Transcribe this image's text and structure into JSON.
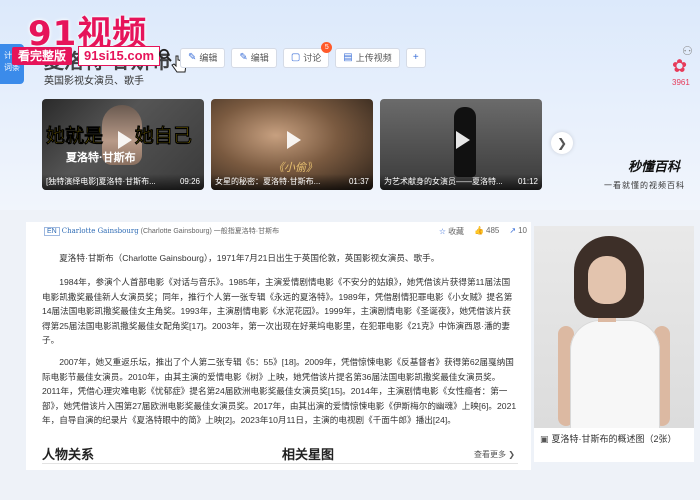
{
  "watermark": {
    "text": "91视频",
    "pill": "看完整版",
    "url": "91si15.com"
  },
  "side_tag": "计划\n词条",
  "header": {
    "title": "夏洛特·甘斯布",
    "subtitle": "英国影视女演员、歌手",
    "toolbar": [
      {
        "icon": "✎",
        "label": "编辑",
        "badge": ""
      },
      {
        "icon": "✎",
        "label": "编辑",
        "badge": ""
      },
      {
        "icon": "▢",
        "label": "讨论",
        "badge": "5"
      },
      {
        "icon": "▤",
        "label": "上传视频",
        "badge": ""
      }
    ],
    "plus_icon": "+",
    "rose_count": "3961"
  },
  "videos": [
    {
      "big": "她就是",
      "big2": "她自己",
      "mid": "夏洛特·甘斯布",
      "caption": "[独特演绎电影]夏洛特·甘斯布...",
      "duration": "09:26"
    },
    {
      "mid": "《小偷》",
      "caption": "女星的秘密：夏洛特·甘斯布...",
      "duration": "01:37"
    },
    {
      "caption": "为艺术献身的女演员——夏洛特...",
      "duration": "01:12"
    }
  ],
  "next_icon": "❯",
  "brand": {
    "name": "秒懂百科",
    "tagline": "一看就懂的视频百科"
  },
  "meta": {
    "tag": "EN",
    "latin": "Charlotte Gainsbourg",
    "latin_paren": "(Charlotte Gainsbourg)",
    "desc": " 一般指夏洛特·甘斯布",
    "collect": "收藏",
    "likes": "485",
    "shares": "10"
  },
  "paragraphs": [
    "夏洛特·甘斯布（Charlotte Gainsbourg），1971年7月21日出生于英国伦敦，英国影视女演员、歌手。",
    "1984年，参演个人首部电影《对话与音乐》。1985年，主演爱情剧情电影《不安分的姑娘》，她凭借该片获得第11届法国电影凯撒奖最佳新人女演员奖；同年，推行个人第一张专辑《永远的夏洛特》。1989年，凭借剧情犯罪电影《小女贼》提名第14届法国电影凯撒奖最佳女主角奖。1993年，主演剧情电影《水泥花园》。1999年，主演剧情电影《圣诞夜》，她凭借该片获得第25届法国电影凯撒奖最佳女配角奖[17]。2003年，第一次出现在好莱坞电影里，在犯罪电影《21克》中饰演西恩·潘的妻子。",
    "2007年，她又重返乐坛，推出了个人第二张专辑《5：55》[18]。2009年，凭借惊悚电影《反基督者》获得第62届戛纳国际电影节最佳女演员。2010年，由其主演的爱情电影《树》上映，她凭借该片提名第36届法国电影凯撒奖最佳女演员奖。2011年，凭借心理灾难电影《忧郁症》提名第24届欧洲电影奖最佳女演员奖[15]。2014年，主演剧情电影《女性瘾者：第一部》，她凭借该片入围第27届欧洲电影奖最佳女演员奖。2017年，由其出演的爱情惊悚电影《伊斯梅尔的幽魂》上映[6]。2021年，自导自演的纪录片《夏洛特眼中的简》上映[2]。2023年10月11日，主演的电视剧《千面牛郎》播出[24]。"
  ],
  "sections": {
    "relations": "人物关系",
    "stars": "相关星图",
    "more": "查看更多 ❯"
  },
  "photo": {
    "caption": "夏洛特·甘斯布的概述图（2张）"
  }
}
